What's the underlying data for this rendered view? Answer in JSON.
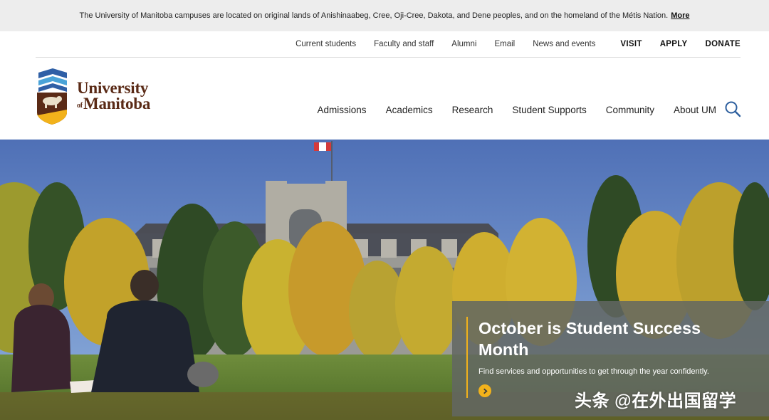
{
  "land_acknowledgement": {
    "text": "The University of Manitoba campuses are located on original lands of Anishinaabeg, Cree, Oji-Cree, Dakota, and Dene peoples, and on the homeland of the Métis Nation.",
    "more_label": "More"
  },
  "utility_nav": {
    "current_students": "Current students",
    "faculty_staff": "Faculty and staff",
    "alumni": "Alumni",
    "email": "Email",
    "news_events": "News and events",
    "visit": "VISIT",
    "apply": "APPLY",
    "donate": "DONATE"
  },
  "logo": {
    "line1": "University",
    "of": "of",
    "line2": "Manitoba"
  },
  "main_nav": {
    "admissions": "Admissions",
    "academics": "Academics",
    "research": "Research",
    "student_supports": "Student Supports",
    "community": "Community",
    "about": "About UM"
  },
  "promo": {
    "title": "October is Student Success Month",
    "description": "Find services and opportunities to get through the year confidently."
  },
  "watermark": "头条 @在外出国留学",
  "colors": {
    "brand_brown": "#5a2a16",
    "accent_gold": "#f2b21b",
    "brand_blue": "#2f5fa6",
    "search_blue": "#2d5f9e"
  },
  "icons": {
    "search": "search-icon",
    "promo_arrow": "chevron-right-icon"
  }
}
